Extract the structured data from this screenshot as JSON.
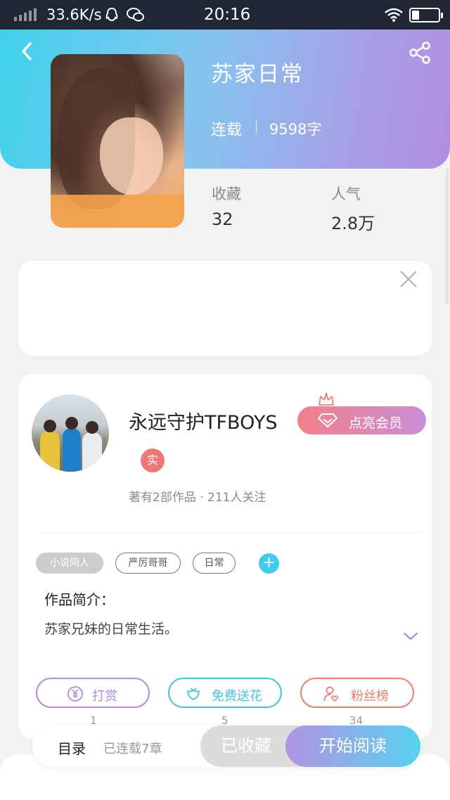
{
  "status_bar": {
    "speed": "33.6K/s",
    "time": "20:16"
  },
  "book": {
    "title": "苏家日常",
    "status": "连载",
    "word_count": "9598字",
    "stats": [
      {
        "label": "收藏",
        "value": "32"
      },
      {
        "label": "人气",
        "value": "2.8万"
      }
    ]
  },
  "author": {
    "name": "永远守护TFBOYS",
    "vip_button": "点亮会员",
    "real_badge": "实",
    "meta": "著有2部作品 · 211人关注"
  },
  "tags": [
    "小说同人",
    "严厉哥哥",
    "日常"
  ],
  "tag_add": "+",
  "intro": {
    "heading": "作品简介：",
    "text": "苏家兄妹的日常生活。"
  },
  "actions": [
    {
      "label": "打赏",
      "count": "1",
      "color": "#b48bdc"
    },
    {
      "label": "免费送花",
      "count": "5",
      "color": "#3fc7d9"
    },
    {
      "label": "粉丝榜",
      "count": "34",
      "color": "#ee7a70"
    }
  ],
  "bottom_bar": {
    "toc_label": "目录",
    "toc_count": "已连载7章",
    "collected": "已收藏",
    "read": "开始阅读"
  },
  "colors": {
    "header_gradient_start": "#3fd2ec",
    "header_gradient_end": "#b18fe0",
    "accent_cyan": "#3fcdec",
    "vip_gradient_start": "#f37f88",
    "vip_gradient_end": "#c98fd6"
  },
  "icons": {
    "back": "back-arrow-icon",
    "share": "share-icon",
    "close": "close-icon",
    "vip": "diamond-icon",
    "crown": "crown-icon",
    "expand": "chevron-down-icon",
    "reward": "yen-coin-icon",
    "flower": "flower-icon",
    "fans": "fan-user-icon"
  }
}
